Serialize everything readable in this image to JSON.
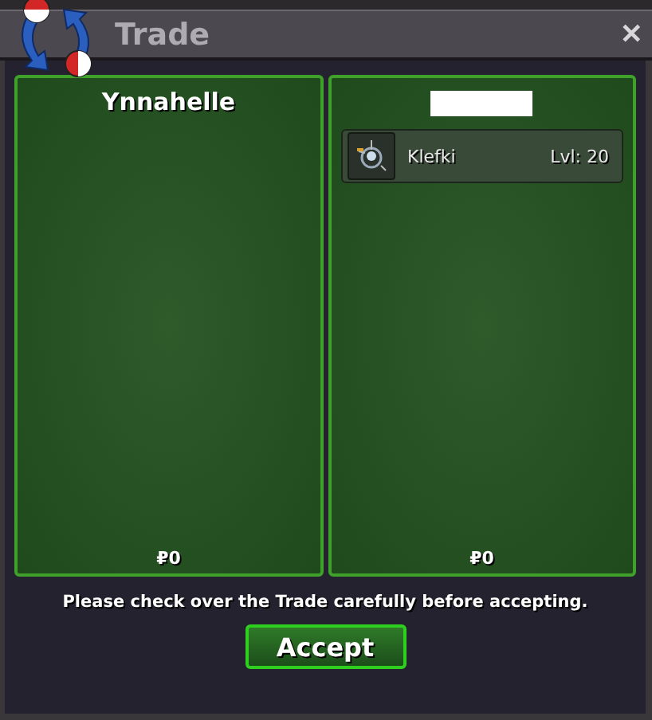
{
  "window": {
    "title": "Trade",
    "close": "✕"
  },
  "panels": [
    {
      "player": {
        "kind": "name",
        "name": "Ynnahelle"
      },
      "money": "₽0"
    },
    {
      "player": {
        "kind": "redacted"
      },
      "items": [
        {
          "name": "Klefki",
          "level": "Lvl: 20"
        }
      ],
      "money": "₽0"
    }
  ],
  "notice": "Please check over the Trade carefully before accepting.",
  "accept_button": "Accept"
}
